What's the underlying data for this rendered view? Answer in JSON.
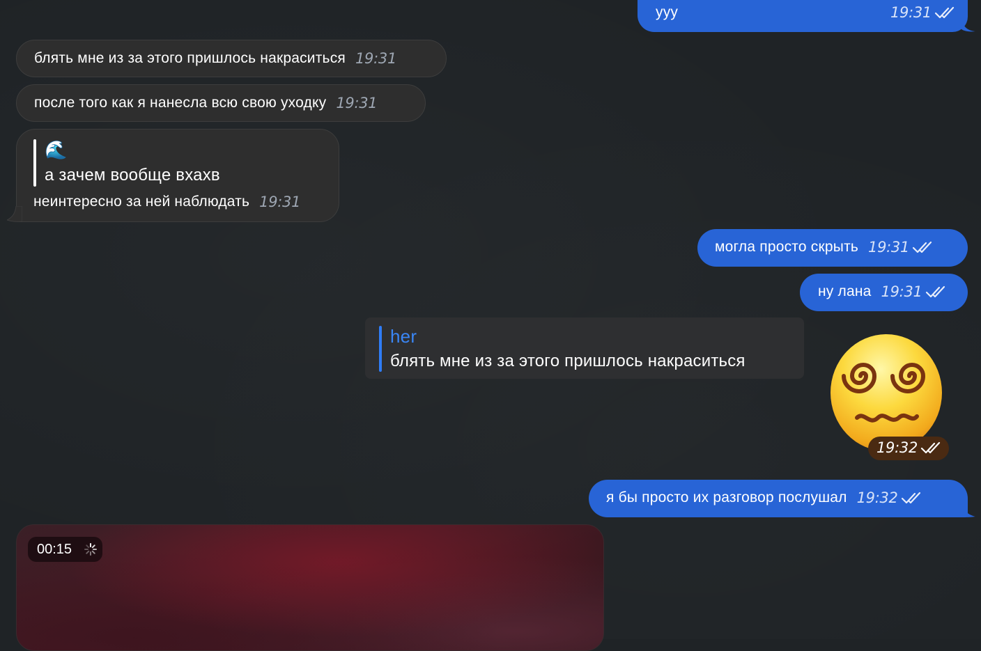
{
  "messages": {
    "m1": {
      "text": "ууу",
      "time": "19:31"
    },
    "m2": {
      "text": "блять мне из за этого пришлось накраситься",
      "time": "19:31"
    },
    "m3": {
      "text": "после того как я нанесла всю свою уходку",
      "time": "19:31"
    },
    "m4": {
      "reply_emoji": "🌊",
      "reply_text": "а зачем вообще вхахв",
      "text": "неинтересно за ней наблюдать",
      "time": "19:31"
    },
    "m5": {
      "text": "могла просто скрыть",
      "time": "19:31"
    },
    "m6": {
      "text": "ну лана",
      "time": "19:31"
    },
    "m7": {
      "reply_author": "her",
      "reply_text": "блять мне из за этого пришлось накраситься",
      "time": "19:32"
    },
    "m8": {
      "text": "я бы просто их разговор послушал",
      "time": "19:32"
    },
    "m9": {
      "duration": "00:15"
    }
  },
  "colors": {
    "background": "#1f2326",
    "incoming_bubble": "#2e2e2e",
    "outgoing_bubble": "#2864d6",
    "reply_accent": "#2f7cf6",
    "time_in": "#9ea7b3",
    "time_out": "#d8e3f8"
  },
  "icons": {
    "read_receipt": "double-check-icon",
    "sticker": "face-with-spiral-eyes-sticker",
    "loading": "spinner-icon"
  }
}
